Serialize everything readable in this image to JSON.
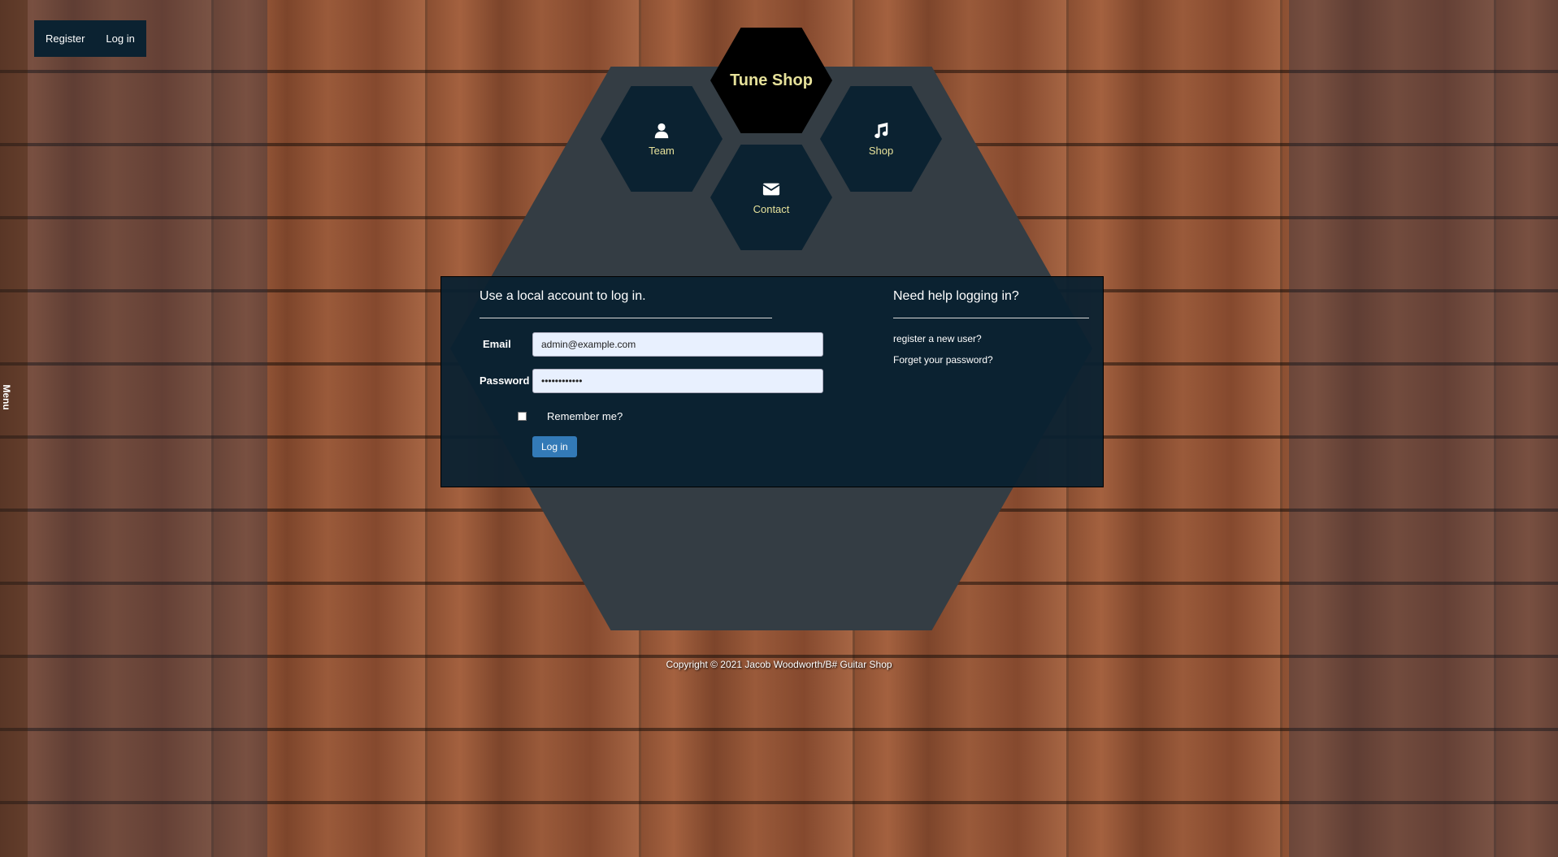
{
  "sidebar": {
    "menu_label": "Menu"
  },
  "topnav": {
    "register_label": "Register",
    "login_label": "Log in"
  },
  "hexnav": {
    "brand": "Tune Shop",
    "team": {
      "label": "Team",
      "icon": "user-icon"
    },
    "shop": {
      "label": "Shop",
      "icon": "music-note-icon"
    },
    "contact": {
      "label": "Contact",
      "icon": "envelope-icon"
    }
  },
  "login": {
    "title": "Use a local account to log in.",
    "email_label": "Email",
    "email_value": "admin@example.com",
    "password_label": "Password",
    "password_value": "••••••••••••",
    "remember_label": "Remember me?",
    "submit_label": "Log in"
  },
  "help": {
    "title": "Need help logging in?",
    "register_link": "register a new user?",
    "forgot_link": "Forget your password?"
  },
  "footer": {
    "copyright": "Copyright © 2021 Jacob Woodworth/B# Guitar Shop"
  },
  "colors": {
    "accent": "#e6e19a",
    "panel": "#0b2231",
    "button": "#337ab7"
  }
}
